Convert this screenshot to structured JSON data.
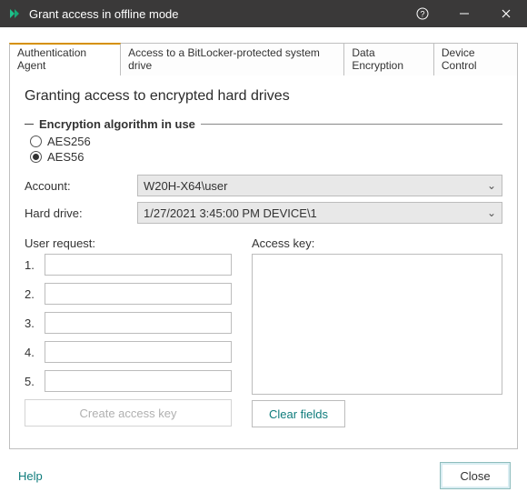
{
  "window": {
    "title": "Grant access in offline mode"
  },
  "tabs": {
    "t0": "Authentication Agent",
    "t1": "Access to a BitLocker-protected system drive",
    "t2": "Data Encryption",
    "t3": "Device Control"
  },
  "main": {
    "heading": "Granting access to encrypted hard drives",
    "fieldset_legend": "Encryption algorithm in use",
    "radio_aes256": "AES256",
    "radio_aes56": "AES56",
    "account_label": "Account:",
    "account_value": "W20H-X64\\user",
    "hdd_label": "Hard drive:",
    "hdd_value": "1/27/2021 3:45:00 PM  DEVICE\\1",
    "user_request_label": "User request:",
    "access_key_label": "Access key:",
    "rows": {
      "r1": "1.",
      "r2": "2.",
      "r3": "3.",
      "r4": "4.",
      "r5": "5."
    },
    "create_btn": "Create access key",
    "clear_btn": "Clear fields"
  },
  "footer": {
    "help": "Help",
    "close": "Close"
  }
}
